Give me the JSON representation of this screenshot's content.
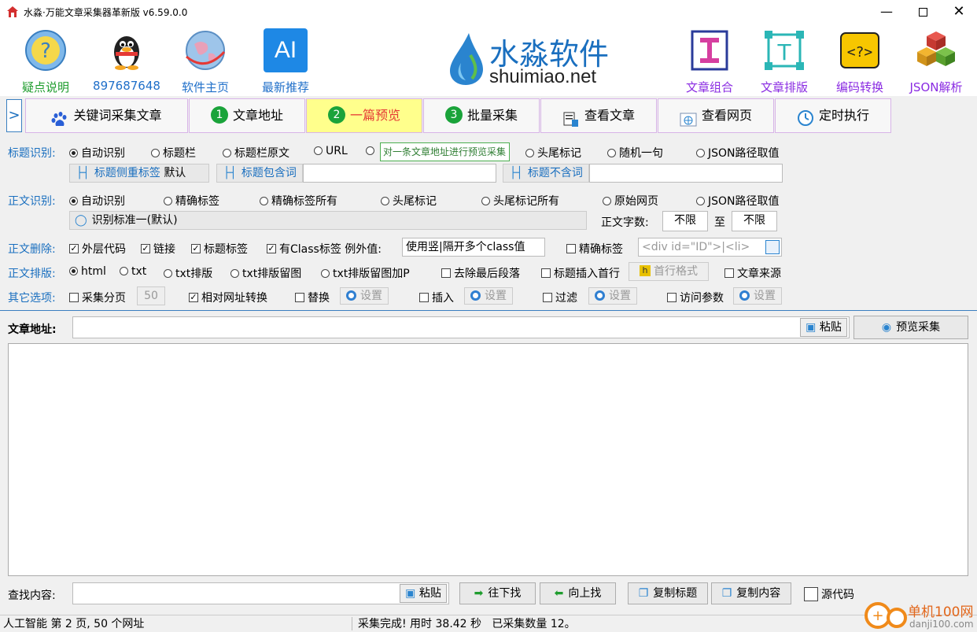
{
  "window": {
    "title": "水淼·万能文章采集器革新版 v6.59.0.0"
  },
  "toolbar": {
    "items": [
      {
        "label": "疑点说明",
        "color": "#1f9d2e"
      },
      {
        "label": "897687648",
        "color": "#1f6fc9"
      },
      {
        "label": "软件主页",
        "color": "#1f6fc9"
      },
      {
        "label": "最新推荐",
        "color": "#1f6fc9"
      }
    ],
    "right_items": [
      {
        "label": "文章组合",
        "color": "#8a2be2"
      },
      {
        "label": "文章排版",
        "color": "#8a2be2"
      },
      {
        "label": "编码转换",
        "color": "#8a2be2"
      },
      {
        "label": "JSON解析",
        "color": "#8a2be2"
      }
    ],
    "logo_cn": "水淼软件",
    "logo_en": "shuimiao.net",
    "ai_text": "AI"
  },
  "tabs": [
    {
      "label": "关键词采集文章"
    },
    {
      "label": "文章地址",
      "num": "1"
    },
    {
      "label": "一篇预览",
      "num": "2"
    },
    {
      "label": "批量采集",
      "num": "3"
    },
    {
      "label": "查看文章"
    },
    {
      "label": "查看网页"
    },
    {
      "label": "定时执行"
    }
  ],
  "tab_toggle": ">",
  "tooltip": "对一条文章地址进行预览采集",
  "title_detect": {
    "label": "标题识别:",
    "options": [
      "自动识别",
      "标题栏",
      "标题栏原文",
      "URL",
      "头尾标记",
      "随机一句",
      "JSON路径取值"
    ],
    "side_tag": "标题侧重标签",
    "side_tag_val": "默认",
    "contains": "标题包含词",
    "not_contains": "标题不含词"
  },
  "body_detect": {
    "label": "正文识别:",
    "options": [
      "自动识别",
      "精确标签",
      "精确标签所有",
      "头尾标记",
      "头尾标记所有",
      "原始网页",
      "JSON路径取值"
    ],
    "standard": "识别标准一(默认)",
    "count_label": "正文字数:",
    "min": "不限",
    "to": "至",
    "max": "不限"
  },
  "body_delete": {
    "label": "正文删除:",
    "outer": "外层代码",
    "link": "链接",
    "title_tag": "标题标签",
    "class_tag": "有Class标签 例外值:",
    "class_input": "使用竖|隔开多个class值",
    "exact": "精确标签",
    "exact_placeholder": "<div id=\"ID\">|<li>"
  },
  "body_format": {
    "label": "正文排版:",
    "options": [
      "html",
      "txt",
      "txt排版",
      "txt排版留图",
      "txt排版留图加P"
    ],
    "remove_last": "去除最后段落",
    "insert_title": "标题插入首行",
    "first_format": "首行格式",
    "source": "文章来源"
  },
  "other": {
    "label": "其它选项:",
    "paging": "采集分页",
    "paging_val": "50",
    "relative": "相对网址转换",
    "replace": "替换",
    "insert": "插入",
    "filter": "过滤",
    "visit": "访问参数",
    "settings": "设置"
  },
  "address": {
    "label": "文章地址:",
    "paste": "粘贴",
    "preview": "预览采集"
  },
  "find": {
    "label": "查找内容:",
    "paste": "粘贴",
    "down": "往下找",
    "up": "向上找",
    "copy_title": "复制标题",
    "copy_content": "复制内容",
    "source_code": "源代码"
  },
  "status": {
    "left": "人工智能 第 2 页, 50 个网址",
    "right": "采集完成! 用时 38.42 秒   已采集数量 12。"
  },
  "watermark": {
    "cn": "单机100网",
    "en": "danji100.com"
  }
}
